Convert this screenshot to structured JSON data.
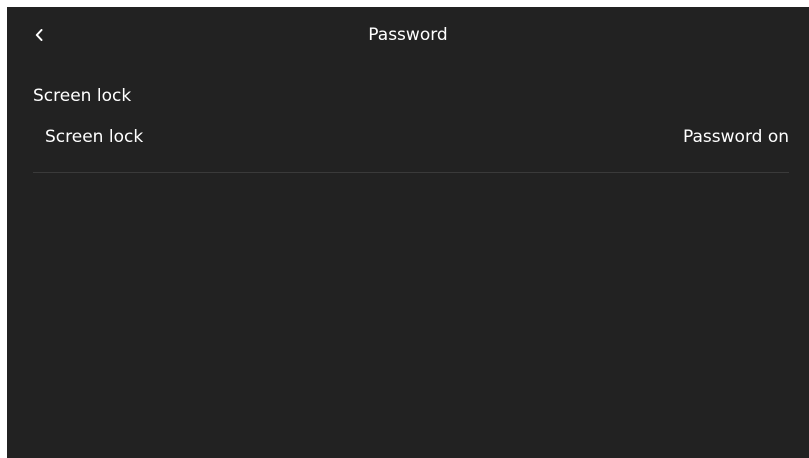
{
  "header": {
    "title": "Password",
    "back_icon": "back-arrow-icon"
  },
  "section": {
    "title": "Screen lock"
  },
  "rows": [
    {
      "label": "Screen lock",
      "value": "Password on"
    }
  ],
  "colors": {
    "background": "#222222",
    "text": "#ffffff",
    "divider": "#3a3a3a"
  }
}
